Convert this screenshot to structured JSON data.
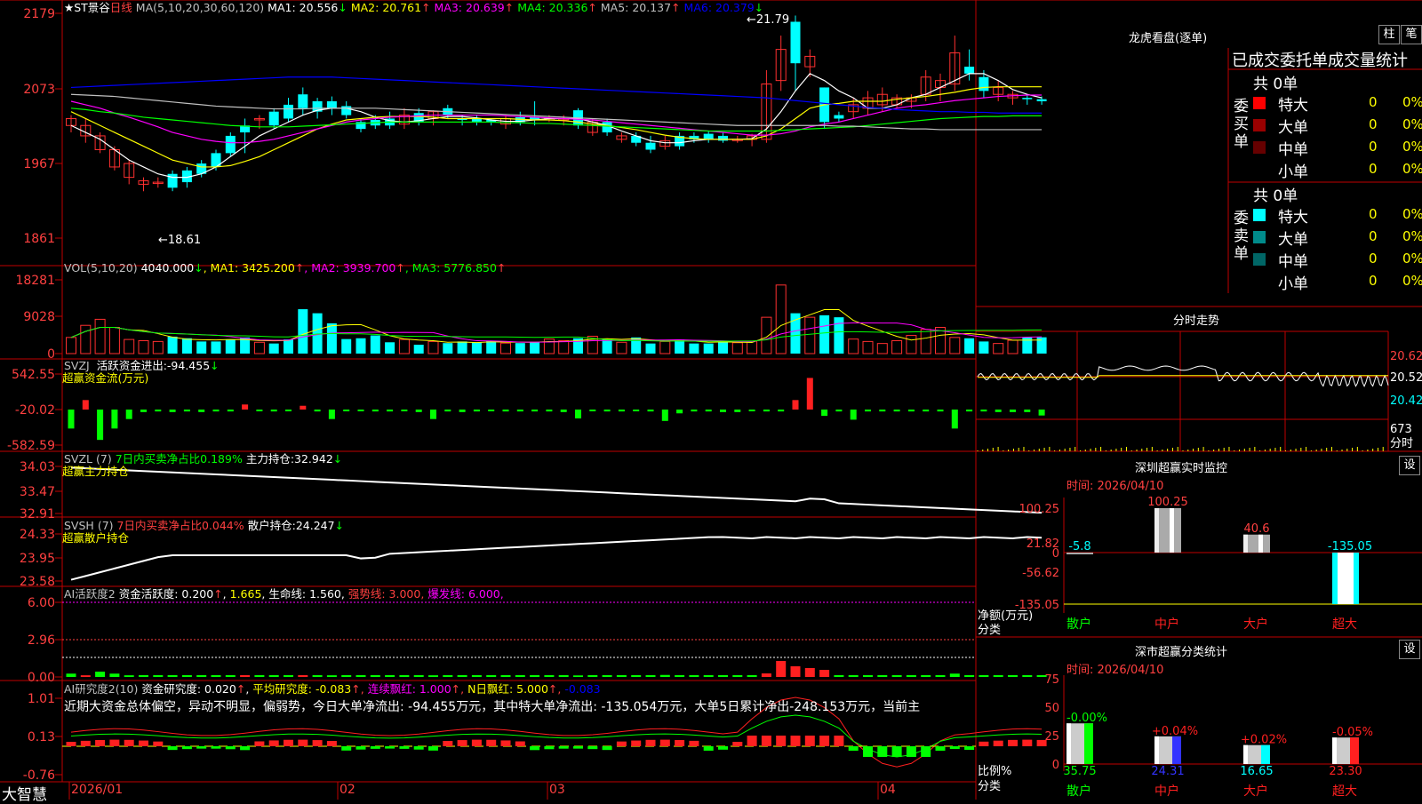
{
  "main": {
    "stock_title": "★ST景谷",
    "period": "日线",
    "ma_def": "MA(5,10,20,30,60,120)",
    "ma_values": [
      {
        "label": "MA1:",
        "value": "20.556",
        "arrow": "↓",
        "color": "#ffffff"
      },
      {
        "label": "MA2:",
        "value": "20.761",
        "arrow": "↑",
        "color": "#ffff00"
      },
      {
        "label": "MA3:",
        "value": "20.639",
        "arrow": "↑",
        "color": "#ff00ff"
      },
      {
        "label": "MA4:",
        "value": "20.336",
        "arrow": "↑",
        "color": "#00ff00"
      },
      {
        "label": "MA5:",
        "value": "20.137",
        "arrow": "↑",
        "color": "#c0c0c0"
      },
      {
        "label": "MA6:",
        "value": "20.379",
        "arrow": "↓",
        "color": "#0000ff"
      }
    ],
    "price_axis": [
      "2179",
      "2073",
      "1967",
      "1861"
    ],
    "high_label": "←21.79",
    "low_label": "←18.61",
    "candles": [
      [
        20.2,
        20.3,
        20.1,
        20.35
      ],
      [
        20.05,
        20.2,
        19.95,
        20.3
      ],
      [
        19.85,
        20.05,
        19.8,
        20.1
      ],
      [
        19.6,
        19.85,
        19.55,
        19.9
      ],
      [
        19.45,
        19.65,
        19.35,
        19.7
      ],
      [
        19.35,
        19.4,
        19.25,
        19.45
      ],
      [
        19.38,
        19.38,
        19.3,
        19.45
      ],
      [
        19.5,
        19.3,
        19.25,
        19.55
      ],
      [
        19.55,
        19.38,
        19.3,
        19.6
      ],
      [
        19.65,
        19.5,
        19.45,
        19.7
      ],
      [
        19.8,
        19.6,
        19.55,
        19.85
      ],
      [
        20.05,
        19.8,
        19.75,
        20.1
      ],
      [
        20.2,
        20.1,
        19.8,
        20.3
      ],
      [
        20.3,
        20.3,
        20.15,
        20.35
      ],
      [
        20.4,
        20.2,
        20.15,
        20.45
      ],
      [
        20.5,
        20.3,
        20.25,
        20.6
      ],
      [
        20.65,
        20.45,
        20.35,
        20.75
      ],
      [
        20.55,
        20.4,
        20.3,
        20.6
      ],
      [
        20.55,
        20.45,
        20.35,
        20.62
      ],
      [
        20.48,
        20.35,
        20.3,
        20.55
      ],
      [
        20.25,
        20.15,
        20.1,
        20.3
      ],
      [
        20.28,
        20.2,
        20.15,
        20.35
      ],
      [
        20.3,
        20.2,
        20.15,
        20.4
      ],
      [
        20.22,
        20.35,
        20.15,
        20.45
      ],
      [
        20.38,
        20.25,
        20.2,
        20.45
      ],
      [
        20.3,
        20.4,
        20.2,
        20.42
      ],
      [
        20.45,
        20.35,
        20.3,
        20.5
      ],
      [
        20.3,
        20.28,
        20.2,
        20.35
      ],
      [
        20.3,
        20.25,
        20.2,
        20.35
      ],
      [
        20.28,
        20.25,
        20.2,
        20.3
      ],
      [
        20.22,
        20.3,
        20.15,
        20.35
      ],
      [
        20.32,
        20.25,
        20.2,
        20.4
      ],
      [
        20.32,
        20.28,
        20.2,
        20.55
      ],
      [
        20.3,
        20.3,
        20.25,
        20.35
      ],
      [
        20.3,
        20.3,
        20.2,
        20.35
      ],
      [
        20.42,
        20.2,
        20.15,
        20.45
      ],
      [
        20.1,
        20.25,
        20.05,
        20.3
      ],
      [
        20.25,
        20.1,
        20.05,
        20.3
      ],
      [
        20.0,
        20.05,
        19.95,
        20.1
      ],
      [
        20.05,
        19.95,
        19.9,
        20.1
      ],
      [
        19.95,
        19.85,
        19.8,
        20.05
      ],
      [
        19.9,
        19.98,
        19.85,
        20.05
      ],
      [
        20.05,
        19.9,
        19.85,
        20.1
      ],
      [
        20.05,
        20.0,
        19.95,
        20.1
      ],
      [
        20.08,
        20.0,
        19.95,
        20.12
      ],
      [
        20.05,
        19.98,
        19.95,
        20.1
      ],
      [
        20.0,
        20.0,
        19.95,
        20.05
      ],
      [
        20.0,
        20.05,
        19.9,
        20.08
      ],
      [
        20.0,
        20.8,
        19.95,
        21.0
      ],
      [
        20.85,
        21.3,
        20.7,
        21.5
      ],
      [
        21.7,
        21.1,
        20.7,
        21.79
      ],
      [
        21.05,
        21.2,
        20.9,
        21.3
      ],
      [
        20.75,
        20.25,
        20.15,
        20.75
      ],
      [
        20.35,
        20.3,
        20.25,
        20.4
      ],
      [
        20.4,
        20.5,
        20.3,
        20.6
      ],
      [
        20.45,
        20.6,
        20.35,
        20.7
      ],
      [
        20.5,
        20.65,
        20.4,
        20.75
      ],
      [
        20.5,
        20.6,
        20.45,
        20.65
      ],
      [
        20.55,
        20.6,
        20.45,
        20.65
      ],
      [
        20.65,
        20.9,
        20.55,
        21.0
      ],
      [
        20.75,
        20.85,
        20.55,
        20.95
      ],
      [
        20.8,
        21.25,
        20.7,
        21.5
      ],
      [
        21.05,
        20.95,
        20.85,
        21.3
      ],
      [
        20.9,
        20.7,
        20.6,
        21.0
      ],
      [
        20.65,
        20.75,
        20.55,
        20.85
      ],
      [
        20.6,
        20.65,
        20.5,
        20.7
      ],
      [
        20.6,
        20.58,
        20.5,
        20.65
      ],
      [
        20.58,
        20.55,
        20.5,
        20.62
      ]
    ],
    "ma_lines": {
      "ma1": [
        20.2,
        20.1,
        20.0,
        19.85,
        19.7,
        19.6,
        19.5,
        19.45,
        19.45,
        19.5,
        19.6,
        19.75,
        19.9,
        20.05,
        20.15,
        20.25,
        20.35,
        20.42,
        20.45,
        20.45,
        20.4,
        20.32,
        20.27,
        20.25,
        20.27,
        20.3,
        20.33,
        20.33,
        20.31,
        20.28,
        20.26,
        20.26,
        20.28,
        20.3,
        20.3,
        20.3,
        20.25,
        20.2,
        20.12,
        20.05,
        19.98,
        19.95,
        19.95,
        19.98,
        20.0,
        20.0,
        20.0,
        20.01,
        20.15,
        20.4,
        20.7,
        20.95,
        20.85,
        20.7,
        20.6,
        20.45,
        20.45,
        20.5,
        20.6,
        20.65,
        20.75,
        20.85,
        20.95,
        20.95,
        20.85,
        20.72,
        20.65,
        20.6
      ],
      "ma2": [
        20.4,
        20.3,
        20.2,
        20.1,
        20.0,
        19.9,
        19.8,
        19.7,
        19.65,
        19.6,
        19.6,
        19.62,
        19.68,
        19.75,
        19.85,
        19.95,
        20.05,
        20.15,
        20.22,
        20.28,
        20.3,
        20.32,
        20.33,
        20.33,
        20.33,
        20.32,
        20.3,
        20.3,
        20.3,
        20.3,
        20.3,
        20.29,
        20.28,
        20.28,
        20.27,
        20.25,
        20.22,
        20.2,
        20.17,
        20.14,
        20.1,
        20.06,
        20.03,
        20.01,
        20.0,
        20.0,
        20.0,
        20.0,
        20.05,
        20.15,
        20.3,
        20.45,
        20.5,
        20.52,
        20.55,
        20.55,
        20.55,
        20.58,
        20.6,
        20.62,
        20.65,
        20.68,
        20.72,
        20.75,
        20.76,
        20.76,
        20.76,
        20.76
      ],
      "ma3": [
        20.55,
        20.5,
        20.45,
        20.38,
        20.32,
        20.25,
        20.18,
        20.1,
        20.05,
        20.0,
        19.97,
        19.95,
        19.95,
        19.97,
        20.0,
        20.05,
        20.1,
        20.15,
        20.2,
        20.25,
        20.28,
        20.3,
        20.32,
        20.33,
        20.34,
        20.35,
        20.35,
        20.35,
        20.35,
        20.35,
        20.34,
        20.33,
        20.32,
        20.31,
        20.3,
        20.29,
        20.28,
        20.26,
        20.24,
        20.22,
        20.2,
        20.18,
        20.16,
        20.14,
        20.12,
        20.1,
        20.08,
        20.06,
        20.06,
        20.08,
        20.12,
        20.18,
        20.22,
        20.25,
        20.3,
        20.35,
        20.4,
        20.45,
        20.48,
        20.5,
        20.53,
        20.56,
        20.58,
        20.6,
        20.62,
        20.63,
        20.64,
        20.64
      ],
      "ma4": [
        20.45,
        20.43,
        20.4,
        20.38,
        20.35,
        20.32,
        20.3,
        20.28,
        20.26,
        20.24,
        20.22,
        20.2,
        20.19,
        20.18,
        20.18,
        20.18,
        20.19,
        20.2,
        20.21,
        20.22,
        20.23,
        20.24,
        20.25,
        20.25,
        20.25,
        20.25,
        20.25,
        20.25,
        20.25,
        20.25,
        20.24,
        20.24,
        20.23,
        20.23,
        20.22,
        20.21,
        20.2,
        20.19,
        20.18,
        20.17,
        20.16,
        20.15,
        20.14,
        20.13,
        20.12,
        20.12,
        20.12,
        20.12,
        20.12,
        20.13,
        20.14,
        20.15,
        20.16,
        20.17,
        20.18,
        20.2,
        20.22,
        20.24,
        20.26,
        20.28,
        20.3,
        20.31,
        20.32,
        20.33,
        20.33,
        20.34,
        20.34,
        20.34
      ],
      "ma5": [
        20.65,
        20.64,
        20.63,
        20.62,
        20.6,
        20.58,
        20.56,
        20.54,
        20.52,
        20.5,
        20.48,
        20.47,
        20.46,
        20.45,
        20.44,
        20.44,
        20.44,
        20.45,
        20.45,
        20.45,
        20.45,
        20.45,
        20.44,
        20.43,
        20.42,
        20.41,
        20.4,
        20.39,
        20.38,
        20.37,
        20.36,
        20.35,
        20.34,
        20.33,
        20.32,
        20.31,
        20.3,
        20.29,
        20.28,
        20.27,
        20.26,
        20.25,
        20.24,
        20.23,
        20.22,
        20.21,
        20.2,
        20.2,
        20.2,
        20.2,
        20.2,
        20.2,
        20.2,
        20.19,
        20.19,
        20.18,
        20.17,
        20.16,
        20.15,
        20.15,
        20.14,
        20.14,
        20.14,
        20.14,
        20.14,
        20.14,
        20.14,
        20.14
      ],
      "ma6": [
        20.75,
        20.76,
        20.77,
        20.78,
        20.79,
        20.8,
        20.81,
        20.82,
        20.83,
        20.84,
        20.85,
        20.86,
        20.87,
        20.88,
        20.89,
        20.9,
        20.9,
        20.9,
        20.9,
        20.89,
        20.88,
        20.87,
        20.86,
        20.85,
        20.84,
        20.83,
        20.82,
        20.81,
        20.8,
        20.79,
        20.78,
        20.77,
        20.76,
        20.75,
        20.74,
        20.73,
        20.72,
        20.71,
        20.7,
        20.69,
        20.68,
        20.67,
        20.66,
        20.65,
        20.64,
        20.63,
        20.62,
        20.61,
        20.6,
        20.58,
        20.56,
        20.54,
        20.52,
        20.5,
        20.48,
        20.46,
        20.45,
        20.43,
        20.42,
        20.41,
        20.4,
        20.4,
        20.39,
        20.39,
        20.38,
        20.38,
        20.38,
        20.38
      ]
    }
  },
  "vol": {
    "def": "VOL(5,10,20)",
    "value": "4040.000",
    "arrow": "↓",
    "ma": [
      {
        "label": "MA1:",
        "value": "3425.200",
        "arrow": "↑",
        "color": "#ffff00"
      },
      {
        "label": "MA2:",
        "value": "3939.700",
        "arrow": "↑",
        "color": "#ff00ff"
      },
      {
        "label": "MA3:",
        "value": "5776.850",
        "arrow": "↑",
        "color": "#00ff00"
      }
    ],
    "axis": [
      "18281",
      "9028",
      "0"
    ],
    "bars": [
      4000,
      7000,
      8500,
      6500,
      3500,
      3200,
      3000,
      4200,
      3800,
      3000,
      3000,
      3500,
      4000,
      2800,
      2500,
      3500,
      11000,
      10000,
      7500,
      3600,
      3800,
      4500,
      2800,
      3500,
      2200,
      3000,
      2600,
      3000,
      2800,
      3200,
      2600,
      2600,
      2900,
      3600,
      3200,
      3800,
      4300,
      3500,
      2800,
      4000,
      2500,
      3000,
      3500,
      2500,
      2500,
      3000,
      2700,
      3100,
      9000,
      17000,
      10000,
      9000,
      9500,
      9000,
      3600,
      3000,
      2500,
      3200,
      4500,
      6000,
      6500,
      4000,
      3800,
      3000,
      2500,
      3300,
      4000,
      4040
    ]
  },
  "svzj": {
    "name": "SVZJ",
    "label": "活跃资金进出:",
    "value": "-94.455",
    "arrow": "↓",
    "sub": "超赢资金流(万元)",
    "axis": [
      "542.55",
      "-20.02",
      "-582.59"
    ],
    "bars": [
      -300,
      150,
      -480,
      -300,
      -150,
      -40,
      -30,
      -40,
      -30,
      -40,
      -30,
      -30,
      80,
      -20,
      -30,
      -20,
      60,
      -30,
      -150,
      -20,
      -20,
      -30,
      -30,
      -20,
      -40,
      -150,
      -30,
      -40,
      -30,
      -20,
      -30,
      -30,
      -30,
      -30,
      -40,
      -140,
      -20,
      -30,
      -30,
      -20,
      -30,
      -180,
      -60,
      -30,
      -30,
      -40,
      -40,
      -20,
      -30,
      -30,
      150,
      500,
      -100,
      -30,
      -160,
      -30,
      -30,
      -30,
      -30,
      -30,
      -30,
      -300,
      -30,
      -30,
      -40,
      -40,
      -40,
      -94
    ]
  },
  "svzl": {
    "name": "SVZL",
    "params": "(7)",
    "desc": "7日内买卖净占比0.189%",
    "label": "主力持仓:",
    "value": "32.942",
    "arrow": "↓",
    "sub": "超赢主力持仓",
    "axis": [
      "34.03",
      "33.47",
      "32.91"
    ]
  },
  "svsh": {
    "name": "SVSH",
    "params": "(7)",
    "desc": "7日内买卖净占比0.044%",
    "label": "散户持仓:",
    "value": "24.247",
    "arrow": "↓",
    "sub": "超赢散户持仓",
    "axis": [
      "24.33",
      "23.95",
      "23.58"
    ]
  },
  "ai1": {
    "name": "AI活跃度2",
    "label": "资金活跃度:",
    "value": "0.200",
    "v2": "1.665",
    "label2": "生命线:",
    "v3": "1.560",
    "strong": "强势线: 3.000",
    "burst": "爆发线: 6.000",
    "axis": [
      "6.00",
      "2.96",
      "0.00"
    ]
  },
  "ai2": {
    "name": "AI研究度2(10)",
    "label": "资金研究度:",
    "value": "0.020",
    "avg": "平均研究度: -0.083",
    "lianxu": "连续飘红: 1.000",
    "nred": "N日飘红: 5.000",
    "last": "-0.083",
    "text": "近期大资金总体偏空，异动不明显，偏弱势，今日大单净流出: -94.455万元，其中特大单净流出: -135.054万元，大单5日累计净出-248.153万元，当前主",
    "axis": [
      "1.01",
      "0.13",
      "-0.76"
    ]
  },
  "dates": [
    "2026/01",
    "02",
    "03",
    "04"
  ],
  "status_brand": "大智慧",
  "longhu": {
    "title": "龙虎看盘(逐单)",
    "btn_zhu": "柱",
    "btn_bi": "笔",
    "subtitle": "已成交委托单成交量统计",
    "buy": {
      "side": "委买单",
      "total": "共 0单",
      "rows": [
        {
          "name": "特大",
          "val": "0",
          "pct": "0%",
          "color": "#ff0000"
        },
        {
          "name": "大单",
          "val": "0",
          "pct": "0%",
          "color": "#990000"
        },
        {
          "name": "中单",
          "val": "0",
          "pct": "0%",
          "color": "#660000"
        },
        {
          "name": "小单",
          "val": "0",
          "pct": "0%",
          "color": "#000000"
        }
      ]
    },
    "sell": {
      "side": "委卖单",
      "total": "共 0单",
      "rows": [
        {
          "name": "特大",
          "val": "0",
          "pct": "0%",
          "color": "#00ffff"
        },
        {
          "name": "大单",
          "val": "0",
          "pct": "0%",
          "color": "#008b8b"
        },
        {
          "name": "中单",
          "val": "0",
          "pct": "0%",
          "color": "#006666"
        },
        {
          "name": "小单",
          "val": "0",
          "pct": "0%",
          "color": "#000000"
        }
      ]
    }
  },
  "intraday": {
    "title": "分时走势",
    "axis": [
      "20.62",
      "20.52",
      "20.42"
    ],
    "vol_label": "673",
    "vol_unit": "分时"
  },
  "monitor": {
    "title": "深圳超赢实时监控",
    "btn": "设",
    "time": "时间: 2026/04/10",
    "axis": [
      "100.25",
      "21.82",
      "0",
      "-56.62",
      "-135.05"
    ],
    "ylabel": "净额(万元)",
    "xlabel": "分类",
    "cats": [
      "散户",
      "中户",
      "大户",
      "超大"
    ],
    "values": [
      -5.8,
      100.25,
      40.6,
      -135.05
    ],
    "labels": [
      "-5.8",
      "100.25",
      "40.6",
      "-135.05"
    ]
  },
  "classify": {
    "title": "深市超赢分类统计",
    "btn": "设",
    "time": "时间: 2026/04/10",
    "axis": [
      "75",
      "50",
      "25",
      "0"
    ],
    "ylabel": "比例%",
    "xlabel": "分类",
    "cats": [
      "散户",
      "中户",
      "大户",
      "超大"
    ],
    "values": [
      35.75,
      24.31,
      16.65,
      23.3
    ],
    "labels": [
      "35.75",
      "24.31",
      "16.65",
      "23.30"
    ],
    "changes": [
      "-0.00%",
      "+0.04%",
      "+0.02%",
      "-0.05%"
    ],
    "colors": [
      "#00ff00",
      "#3333ff",
      "#00ffff",
      "#ff2020"
    ]
  }
}
